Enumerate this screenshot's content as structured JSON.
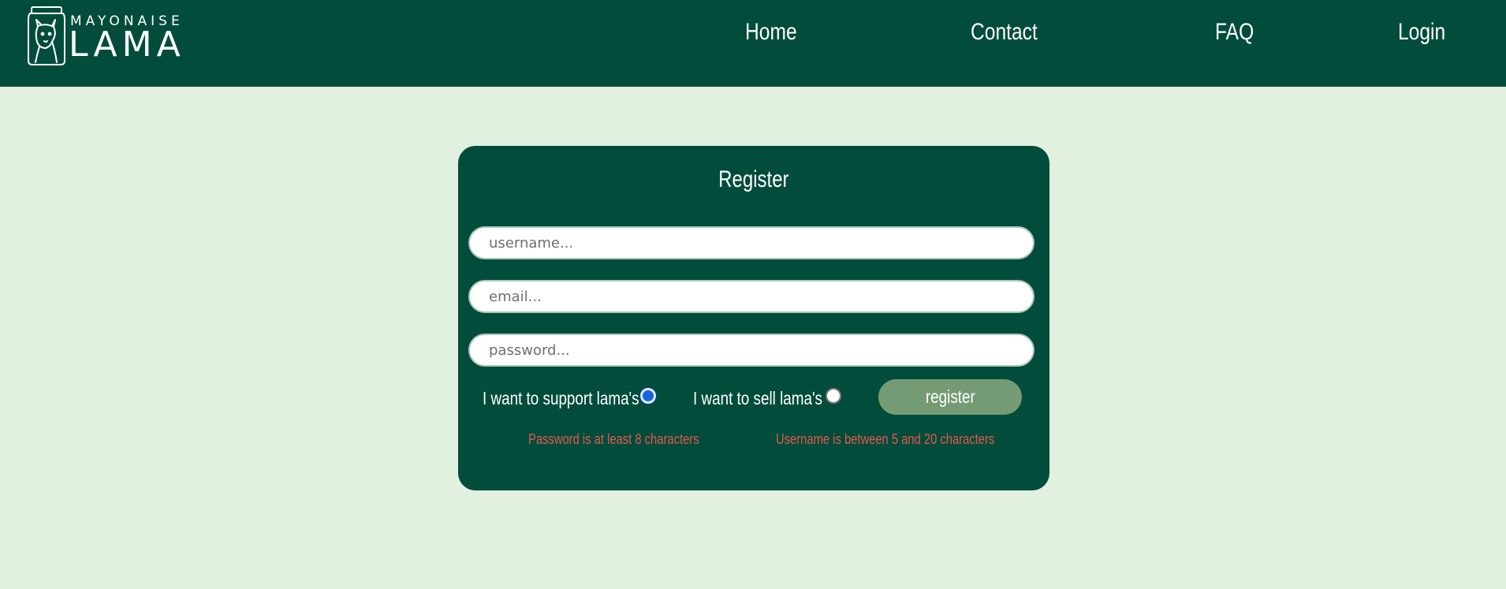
{
  "header": {
    "logo": {
      "top_text": "MAYONAISE",
      "main_text": "LAMA"
    },
    "nav": [
      {
        "label": "Home"
      },
      {
        "label": "Contact"
      },
      {
        "label": "FAQ"
      },
      {
        "label": "Login"
      }
    ]
  },
  "register_form": {
    "title": "Register",
    "username_placeholder": "username...",
    "email_placeholder": "email...",
    "password_placeholder": "password...",
    "support_option_label": "I want to support lama's",
    "sell_option_label": "I want to sell lama's",
    "support_selected": true,
    "sell_selected": false,
    "submit_label": "register",
    "errors": {
      "password": "Password is at least 8 characters",
      "username": "Username is between 5 and 20 characters"
    }
  },
  "colors": {
    "header_bg": "#024c3c",
    "page_bg": "#e1f0df",
    "button_bg": "#749b73",
    "error_text": "#e2584a",
    "radio_selected": "#1565d8"
  }
}
